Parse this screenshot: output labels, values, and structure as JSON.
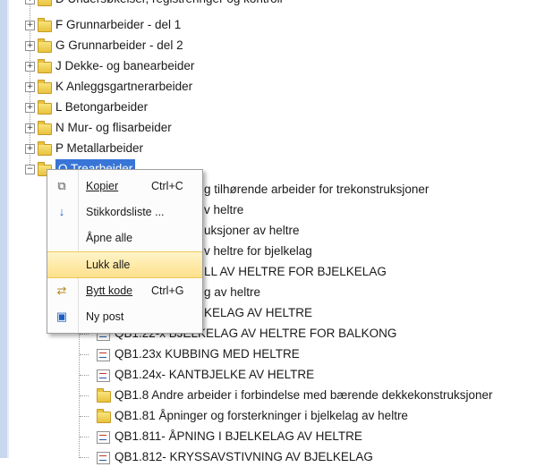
{
  "tree": {
    "top_partial": "D Undersøkelser, registreringer og kontroll",
    "folders": [
      "F Grunnarbeider - del 1",
      "G Grunnarbeider - del 2",
      "J Dekke- og banearbeider",
      "K Anleggsgartnerarbeider",
      "L Betongarbeider",
      "N Mur- og flisarbeider",
      "P Metallarbeider"
    ],
    "selected": "Q Trearbeider",
    "hidden_rows": [
      "g tilhørende arbeider for trekonstruksjoner",
      "v heltre",
      "uksjoner av heltre",
      "v heltre for bjelkelag",
      "LL AV HELTRE FOR BJELKELAG",
      "g av heltre",
      "KELAG AV HELTRE"
    ],
    "visible_rows": [
      "QB1.22-x BJELKELAG AV HELTRE FOR BALKONG",
      "QB1.23x KUBBING MED HELTRE",
      "QB1.24x- KANTBJELKE AV HELTRE",
      "QB1.8 Andre arbeider i forbindelse med bærende dekkekonstruksjoner",
      "QB1.81 Åpninger og forsterkninger i bjelkelag av heltre",
      "QB1.811- ÅPNING I BJELKELAG AV HELTRE",
      "QB1.812- KRYSSAVSTIVNING AV BJELKELAG"
    ]
  },
  "context_menu": {
    "copy": {
      "label": "Kopier",
      "shortcut": "Ctrl+C",
      "icon": "copy-icon"
    },
    "keywords": {
      "label": "Stikkordsliste ...",
      "icon": "arrow-down-icon"
    },
    "open_all": {
      "label": "Åpne alle"
    },
    "close_all": {
      "label": "Lukk alle"
    },
    "swap_code": {
      "label": "Bytt kode",
      "shortcut": "Ctrl+G",
      "icon": "swap-icon"
    },
    "new_post": {
      "label": "Ny post",
      "icon": "new-post-icon"
    }
  }
}
